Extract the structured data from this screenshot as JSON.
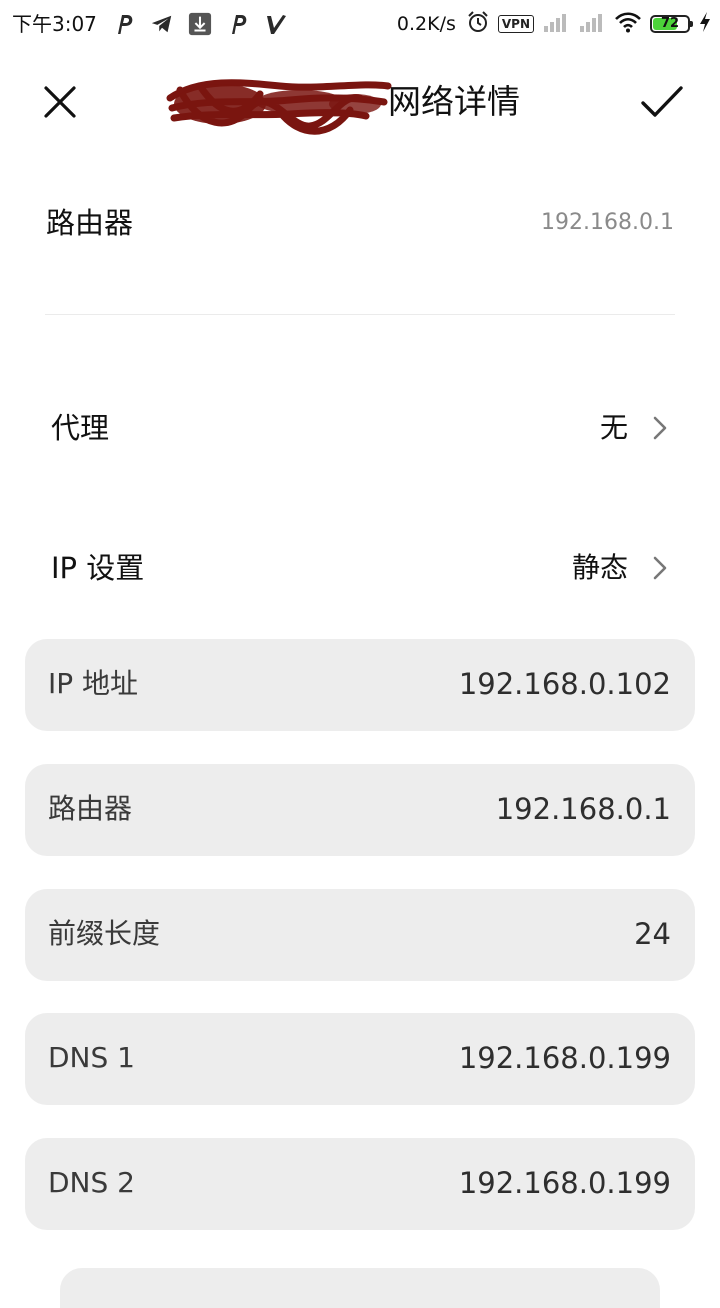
{
  "status_bar": {
    "time": "下午3:07",
    "net_speed": "0.2K/s",
    "vpn_label": "VPN",
    "battery_level": 72,
    "battery_text": "72",
    "icons": [
      "p-app-icon",
      "telegram-icon",
      "download-icon",
      "p-app-icon",
      "v-app-icon",
      "alarm-icon",
      "signal-icon",
      "signal-icon",
      "wifi-icon",
      "charging-icon"
    ]
  },
  "header": {
    "title": "网络详情",
    "close_icon": "close-icon",
    "confirm_icon": "check-icon"
  },
  "info": {
    "router_label": "路由器",
    "router_value": "192.168.0.1"
  },
  "settings": {
    "proxy_label": "代理",
    "proxy_value": "无",
    "ip_settings_label": "IP 设置",
    "ip_settings_value": "静态"
  },
  "static_fields": [
    {
      "label": "IP 地址",
      "value": "192.168.0.102"
    },
    {
      "label": "路由器",
      "value": "192.168.0.1"
    },
    {
      "label": "前缀长度",
      "value": "24"
    },
    {
      "label": "DNS 1",
      "value": "192.168.0.199"
    },
    {
      "label": "DNS 2",
      "value": "192.168.0.199"
    }
  ],
  "colors": {
    "card_bg": "#ededed",
    "secondary_text": "#8a8a8a",
    "redaction": "#7a1510",
    "battery_fill": "#4cd43a"
  }
}
